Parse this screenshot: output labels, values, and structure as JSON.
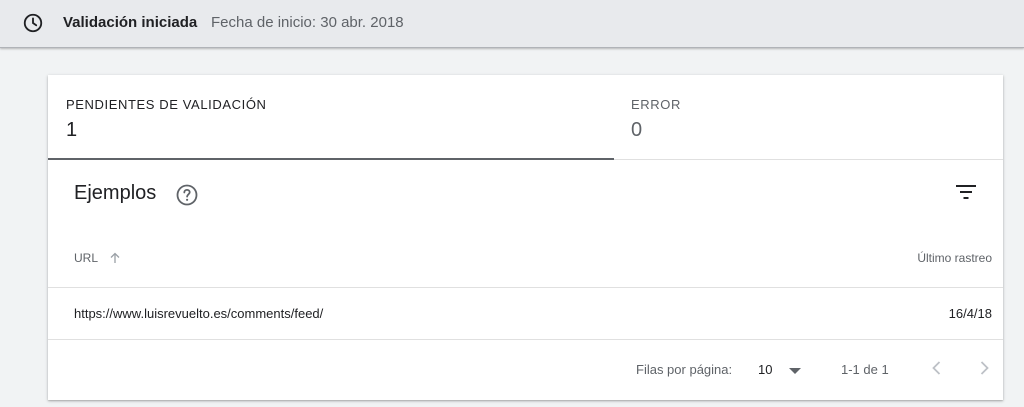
{
  "status_bar": {
    "icon": "clock-icon",
    "title": "Validación iniciada",
    "date": "Fecha de inicio: 30 abr. 2018"
  },
  "tabs": [
    {
      "label": "PENDIENTES DE VALIDACIÓN",
      "count": "1",
      "selected": true
    },
    {
      "label": "ERROR",
      "count": "0",
      "selected": false
    }
  ],
  "examples": {
    "title": "Ejemplos",
    "help_icon": "help-icon",
    "filter_icon": "filter-icon"
  },
  "table": {
    "columns": [
      {
        "label": "URL",
        "sort_icon": "arrow-up-icon"
      },
      {
        "label": "Último rastreo"
      }
    ],
    "rows": [
      {
        "url": "https://www.luisrevuelto.es/comments/feed/",
        "last_crawl": "16/4/18"
      }
    ]
  },
  "pagination": {
    "rows_per_page_label": "Filas por página:",
    "rows_per_page_value": "10",
    "range": "1-1 de 1"
  },
  "colors": {
    "top_bar_bg": "#e8eaed",
    "page_bg": "#f1f3f4",
    "card_bg": "#ffffff",
    "primary_text": "#202124",
    "secondary_text": "#5f6368",
    "selected_tab_indicator": "#5f6368"
  }
}
